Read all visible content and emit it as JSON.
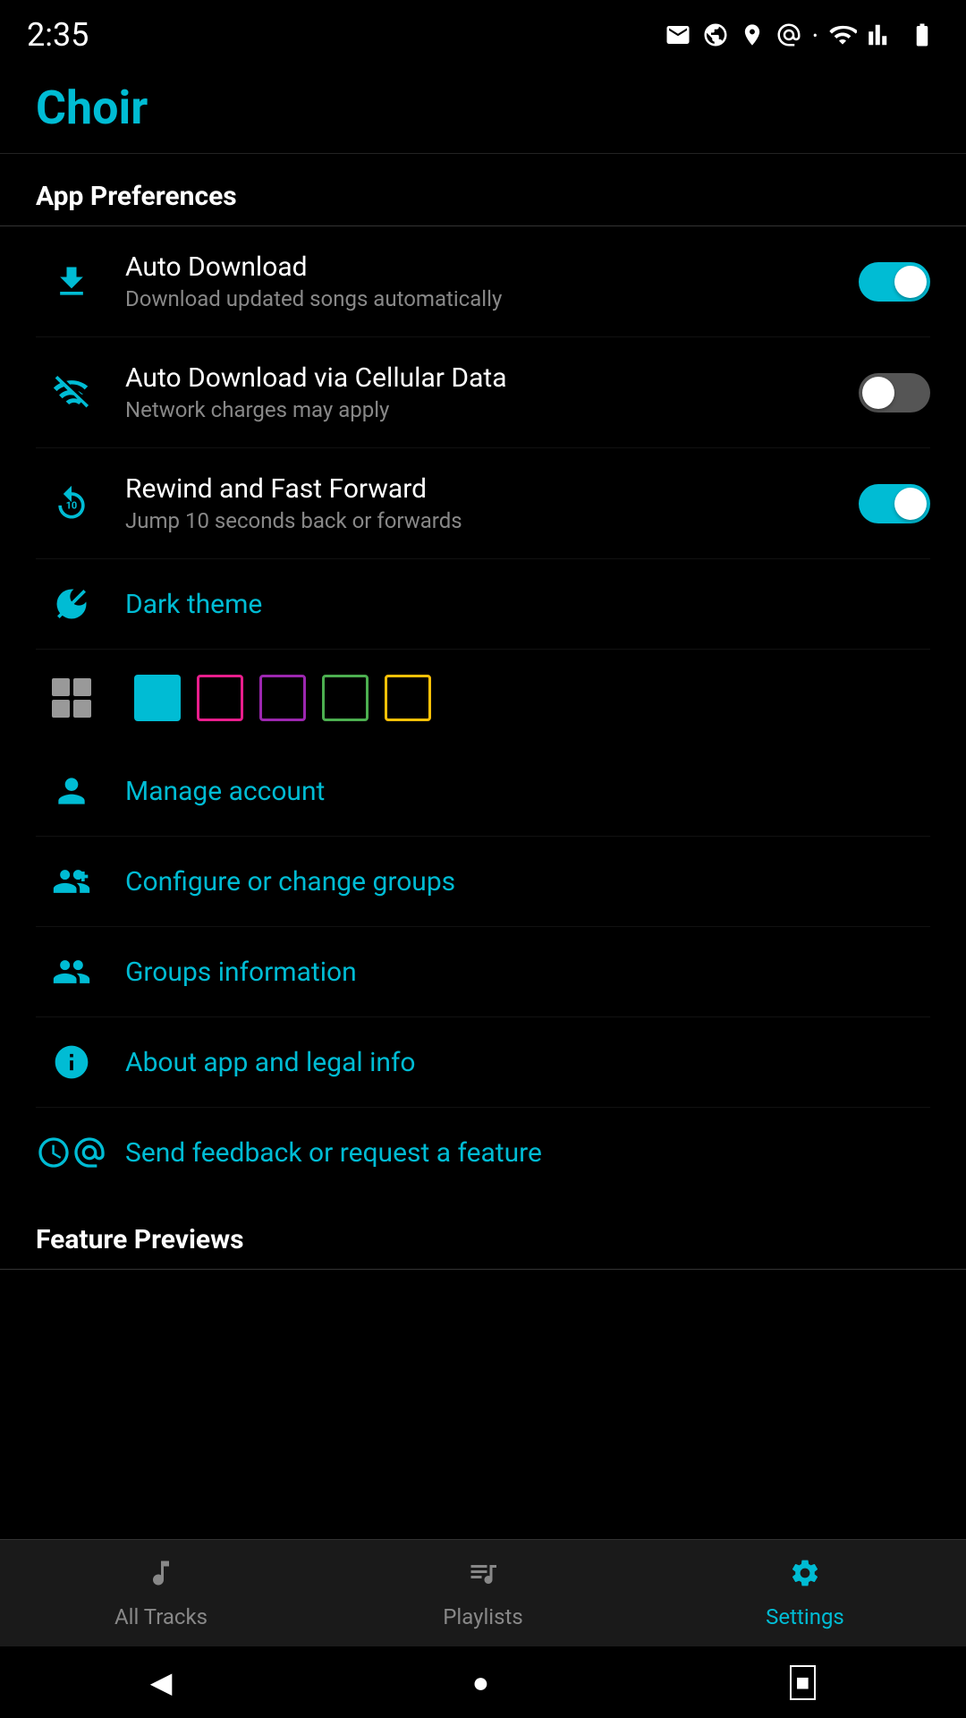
{
  "statusBar": {
    "time": "2:35",
    "icons": [
      "mail",
      "google",
      "location",
      "at",
      "dot",
      "wifi",
      "signal",
      "battery"
    ]
  },
  "appHeader": {
    "title": "Choir"
  },
  "appPreferences": {
    "sectionTitle": "App Preferences",
    "items": [
      {
        "id": "auto-download",
        "title": "Auto Download",
        "subtitle": "Download updated songs automatically",
        "hasToggle": true,
        "toggleState": "on",
        "iconType": "download"
      },
      {
        "id": "auto-download-cellular",
        "title": "Auto Download via Cellular Data",
        "subtitle": "Network charges may apply",
        "hasToggle": true,
        "toggleState": "off",
        "iconType": "no-wifi"
      },
      {
        "id": "rewind-fast-forward",
        "title": "Rewind and Fast Forward",
        "subtitle": "Jump 10 seconds back or forwards",
        "hasToggle": true,
        "toggleState": "on",
        "iconType": "rewind"
      },
      {
        "id": "dark-theme",
        "title": "Dark theme",
        "subtitle": "",
        "hasToggle": false,
        "isLink": true,
        "iconType": "theme"
      }
    ],
    "themeColors": [
      {
        "id": "blue",
        "color": "#00bcd4",
        "type": "solid",
        "selected": true
      },
      {
        "id": "magenta",
        "color": "#e91e8c",
        "type": "outline"
      },
      {
        "id": "purple",
        "color": "#9c27b0",
        "type": "outline"
      },
      {
        "id": "green",
        "color": "#4caf50",
        "type": "outline"
      },
      {
        "id": "yellow",
        "color": "#ffc107",
        "type": "outline"
      }
    ],
    "links": [
      {
        "id": "manage-account",
        "title": "Manage account",
        "iconType": "person"
      },
      {
        "id": "configure-groups",
        "title": "Configure or change groups",
        "iconType": "group-add"
      },
      {
        "id": "groups-information",
        "title": "Groups information",
        "iconType": "groups"
      },
      {
        "id": "about-app",
        "title": "About app and legal info",
        "iconType": "info"
      },
      {
        "id": "send-feedback",
        "title": "Send feedback or request a feature",
        "iconType": "feedback"
      }
    ]
  },
  "featurePreviews": {
    "sectionTitle": "Feature Previews"
  },
  "bottomNav": {
    "items": [
      {
        "id": "all-tracks",
        "label": "All Tracks",
        "icon": "music-note",
        "active": false
      },
      {
        "id": "playlists",
        "label": "Playlists",
        "icon": "playlist",
        "active": false
      },
      {
        "id": "settings",
        "label": "Settings",
        "icon": "gear",
        "active": true
      }
    ]
  },
  "systemNav": {
    "back": "◀",
    "home": "●",
    "recent": "■"
  }
}
